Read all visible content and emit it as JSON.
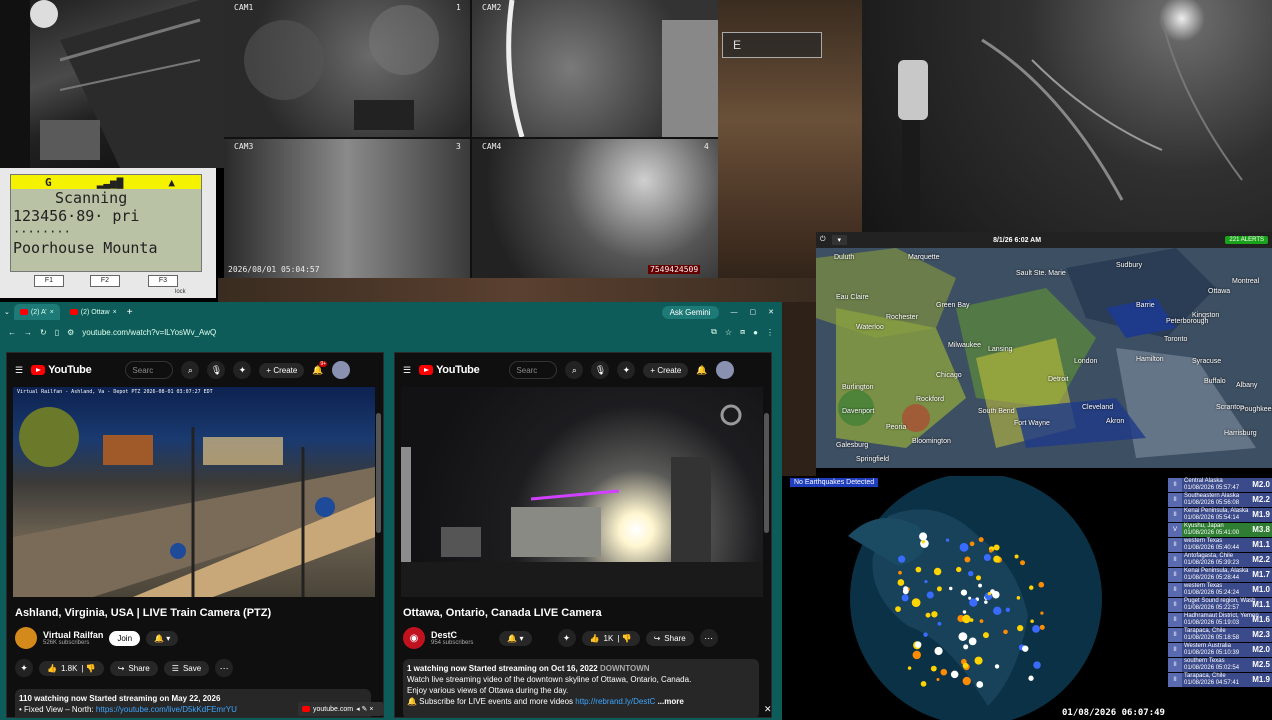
{
  "cameras": {
    "cam1": "CAM1",
    "cam2": "CAM2",
    "cam3": "CAM3",
    "cam4": "CAM4",
    "cam3_num": "3",
    "cam4_num": "4",
    "cam1_num": "1",
    "timestamp": "2026/08/01 05:04:57",
    "counter": "7549424509"
  },
  "game_hud": {
    "compass": "E"
  },
  "scanner": {
    "signal": "G",
    "line1": "Scanning",
    "line2": "123456·89·  pri",
    "line3": "········",
    "line4": "Poorhouse Mounta",
    "f1": "F1",
    "f2": "F2",
    "f3": "F3",
    "lock": "lock"
  },
  "browser": {
    "tab1": "(2) A’",
    "tab2": "(2) Ottaw",
    "new_tab": "+",
    "gemini": "Ask Gemini",
    "url": "youtube.com/watch?v=lLYosWv_AwQ",
    "taskbar_tab": "youtube.com"
  },
  "youtube_left": {
    "logo": "YouTube",
    "search_placeholder": "Searc",
    "create": "Create",
    "notif_count": "9+",
    "overlay": "Virtual Railfan - Ashland, Va - Depot PTZ   2026-08-01 03:07:27 EDT",
    "title": "Ashland, Virginia, USA | LIVE Train Camera (PTZ)",
    "channel": "Virtual Railfan",
    "subs": "526K subscribers",
    "join": "Join",
    "likes": "1.8K",
    "share": "Share",
    "save": "Save",
    "desc_line1": "110 watching now  Started streaming on May 22, 2026",
    "desc_line2": "• Fixed View – North:",
    "desc_link": "https://youtube.com/live/D5kKdFEmrYU"
  },
  "youtube_right": {
    "logo": "YouTube",
    "search_placeholder": "Searc",
    "create": "Create",
    "title": "Ottawa, Ontario, Canada LIVE Camera",
    "channel": "DestC",
    "subs": "954 subscribers",
    "likes": "1K",
    "share": "Share",
    "desc_line1": "1 watching now  Started streaming on Oct 16, 2022",
    "desc_tag": "DOWNTOWN",
    "desc_line2": "Watch live streaming video of the downtown skyline of Ottawa, Ontario, Canada.",
    "desc_line3": "Enjoy various views of Ottawa during the day.",
    "desc_line4": "🔔 Subscribe for LIVE events and more videos",
    "desc_link": "http://rebrand.ly/DestC",
    "more": "...more"
  },
  "radar": {
    "datetime": "8/1/26 6:02 AM",
    "alerts": "221 ALERTS",
    "cities": [
      "Ottawa",
      "Montreal",
      "Kingston",
      "Toronto",
      "Hamilton",
      "London",
      "Syracuse",
      "Buffalo",
      "Detroit",
      "Cleveland",
      "Akron",
      "Fort Wayne",
      "Lansing",
      "Chicago",
      "South Bend",
      "Green Bay",
      "Milwaukee",
      "Springfield",
      "Bloomington",
      "Davenport",
      "Galesburg",
      "Peoria",
      "Burlington",
      "Albany",
      "Scranton",
      "Harrisburg",
      "Poughkeepsie",
      "Marquette",
      "Sault Ste. Marie",
      "Sudbury",
      "Rockford",
      "Peterborough",
      "Barrie",
      "Duluth",
      "Eau Claire",
      "Waterloo",
      "Rochester"
    ]
  },
  "quake": {
    "status": "No Earthquakes Detected",
    "time": "01/08/2026 06:07:49",
    "events": [
      {
        "region": "Central Alaska",
        "time": "01/08/2026 05:57:47",
        "mag": "M2.0"
      },
      {
        "region": "Southeastern Alaska",
        "time": "01/08/2026 05:56:08",
        "mag": "M2.2"
      },
      {
        "region": "Kenai Peninsula, Alaska",
        "time": "01/08/2026 05:54:14",
        "mag": "M1.9"
      },
      {
        "region": "Kyushu, Japan",
        "time": "01/08/2026 05:41:00",
        "mag": "M3.8"
      },
      {
        "region": "western Texas",
        "time": "01/08/2026 05:40:44",
        "mag": "M1.1"
      },
      {
        "region": "Antofagasta, Chile",
        "time": "01/08/2026 05:39:23",
        "mag": "M2.2"
      },
      {
        "region": "Kenai Peninsula, Alaska",
        "time": "01/08/2026 05:28:44",
        "mag": "M1.7"
      },
      {
        "region": "western Texas",
        "time": "01/08/2026 05:24:24",
        "mag": "M1.0"
      },
      {
        "region": "Puget Sound region, Wash",
        "time": "01/08/2026 05:22:57",
        "mag": "M1.1"
      },
      {
        "region": "Hadhramaut District, Yemen",
        "time": "01/08/2026 05:19:03",
        "mag": "M1.6"
      },
      {
        "region": "Tarapaca, Chile",
        "time": "01/08/2026 05:18:58",
        "mag": "M2.3"
      },
      {
        "region": "Western Australia",
        "time": "01/08/2026 05:10:39",
        "mag": "M2.0"
      },
      {
        "region": "southern Texas",
        "time": "01/08/2026 05:02:54",
        "mag": "M2.5"
      },
      {
        "region": "Tarapaca, Chile",
        "time": "01/08/2026 04:57:41",
        "mag": "M1.9"
      }
    ]
  }
}
